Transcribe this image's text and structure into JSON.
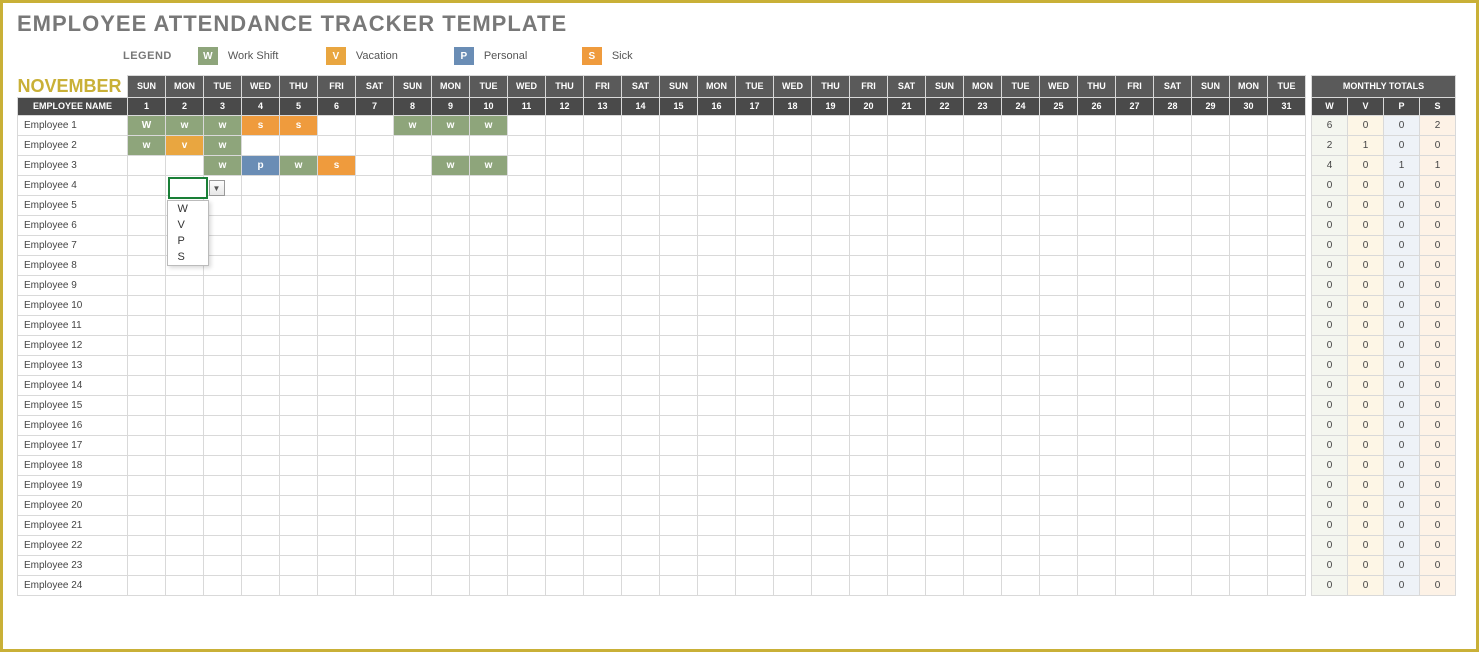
{
  "title": "EMPLOYEE ATTENDANCE TRACKER TEMPLATE",
  "legend": {
    "label": "LEGEND",
    "items": [
      {
        "code": "W",
        "label": "Work Shift",
        "color": "#8ea57b"
      },
      {
        "code": "V",
        "label": "Vacation",
        "color": "#e9a640"
      },
      {
        "code": "P",
        "label": "Personal",
        "color": "#6a8db5"
      },
      {
        "code": "S",
        "label": "Sick",
        "color": "#ef9b3d"
      }
    ]
  },
  "month": "NOVEMBER",
  "headers": {
    "employee": "EMPLOYEE NAME",
    "dow": [
      "SUN",
      "MON",
      "TUE",
      "WED",
      "THU",
      "FRI",
      "SAT",
      "SUN",
      "MON",
      "TUE",
      "WED",
      "THU",
      "FRI",
      "SAT",
      "SUN",
      "MON",
      "TUE",
      "WED",
      "THU",
      "FRI",
      "SAT",
      "SUN",
      "MON",
      "TUE",
      "WED",
      "THU",
      "FRI",
      "SAT",
      "SUN",
      "MON",
      "TUE"
    ],
    "days": [
      "1",
      "2",
      "3",
      "4",
      "5",
      "6",
      "7",
      "8",
      "9",
      "10",
      "11",
      "12",
      "13",
      "14",
      "15",
      "16",
      "17",
      "18",
      "19",
      "20",
      "21",
      "22",
      "23",
      "24",
      "25",
      "26",
      "27",
      "28",
      "29",
      "30",
      "31"
    ],
    "totals_title": "MONTHLY TOTALS",
    "totals": [
      "W",
      "V",
      "P",
      "S"
    ]
  },
  "employees": [
    {
      "name": "Employee 1",
      "cells": {
        "1": "W",
        "2": "W",
        "3": "W",
        "4": "S",
        "5": "S",
        "8": "W",
        "9": "W",
        "10": "W"
      },
      "totals": {
        "W": 6,
        "V": 0,
        "P": 0,
        "S": 2
      }
    },
    {
      "name": "Employee 2",
      "cells": {
        "1": "W",
        "2": "V",
        "3": "W"
      },
      "totals": {
        "W": 2,
        "V": 1,
        "P": 0,
        "S": 0
      }
    },
    {
      "name": "Employee 3",
      "cells": {
        "3": "W",
        "4": "P",
        "5": "W",
        "6": "S",
        "9": "W",
        "10": "W"
      },
      "totals": {
        "W": 4,
        "V": 0,
        "P": 1,
        "S": 1
      }
    },
    {
      "name": "Employee 4",
      "cells": {},
      "totals": {
        "W": 0,
        "V": 0,
        "P": 0,
        "S": 0
      }
    },
    {
      "name": "Employee 5",
      "cells": {},
      "totals": {
        "W": 0,
        "V": 0,
        "P": 0,
        "S": 0
      }
    },
    {
      "name": "Employee 6",
      "cells": {},
      "totals": {
        "W": 0,
        "V": 0,
        "P": 0,
        "S": 0
      }
    },
    {
      "name": "Employee 7",
      "cells": {},
      "totals": {
        "W": 0,
        "V": 0,
        "P": 0,
        "S": 0
      }
    },
    {
      "name": "Employee 8",
      "cells": {},
      "totals": {
        "W": 0,
        "V": 0,
        "P": 0,
        "S": 0
      }
    },
    {
      "name": "Employee 9",
      "cells": {},
      "totals": {
        "W": 0,
        "V": 0,
        "P": 0,
        "S": 0
      }
    },
    {
      "name": "Employee 10",
      "cells": {},
      "totals": {
        "W": 0,
        "V": 0,
        "P": 0,
        "S": 0
      }
    },
    {
      "name": "Employee 11",
      "cells": {},
      "totals": {
        "W": 0,
        "V": 0,
        "P": 0,
        "S": 0
      }
    },
    {
      "name": "Employee 12",
      "cells": {},
      "totals": {
        "W": 0,
        "V": 0,
        "P": 0,
        "S": 0
      }
    },
    {
      "name": "Employee 13",
      "cells": {},
      "totals": {
        "W": 0,
        "V": 0,
        "P": 0,
        "S": 0
      }
    },
    {
      "name": "Employee 14",
      "cells": {},
      "totals": {
        "W": 0,
        "V": 0,
        "P": 0,
        "S": 0
      }
    },
    {
      "name": "Employee 15",
      "cells": {},
      "totals": {
        "W": 0,
        "V": 0,
        "P": 0,
        "S": 0
      }
    },
    {
      "name": "Employee 16",
      "cells": {},
      "totals": {
        "W": 0,
        "V": 0,
        "P": 0,
        "S": 0
      }
    },
    {
      "name": "Employee 17",
      "cells": {},
      "totals": {
        "W": 0,
        "V": 0,
        "P": 0,
        "S": 0
      }
    },
    {
      "name": "Employee 18",
      "cells": {},
      "totals": {
        "W": 0,
        "V": 0,
        "P": 0,
        "S": 0
      }
    },
    {
      "name": "Employee 19",
      "cells": {},
      "totals": {
        "W": 0,
        "V": 0,
        "P": 0,
        "S": 0
      }
    },
    {
      "name": "Employee 20",
      "cells": {},
      "totals": {
        "W": 0,
        "V": 0,
        "P": 0,
        "S": 0
      }
    },
    {
      "name": "Employee 21",
      "cells": {},
      "totals": {
        "W": 0,
        "V": 0,
        "P": 0,
        "S": 0
      }
    },
    {
      "name": "Employee 22",
      "cells": {},
      "totals": {
        "W": 0,
        "V": 0,
        "P": 0,
        "S": 0
      }
    },
    {
      "name": "Employee 23",
      "cells": {},
      "totals": {
        "W": 0,
        "V": 0,
        "P": 0,
        "S": 0
      }
    },
    {
      "name": "Employee 24",
      "cells": {},
      "totals": {
        "W": 0,
        "V": 0,
        "P": 0,
        "S": 0
      }
    }
  ],
  "dropdown": {
    "options": [
      "W",
      "V",
      "P",
      "S"
    ],
    "active_employee_index": 3,
    "active_day_index": 1
  }
}
